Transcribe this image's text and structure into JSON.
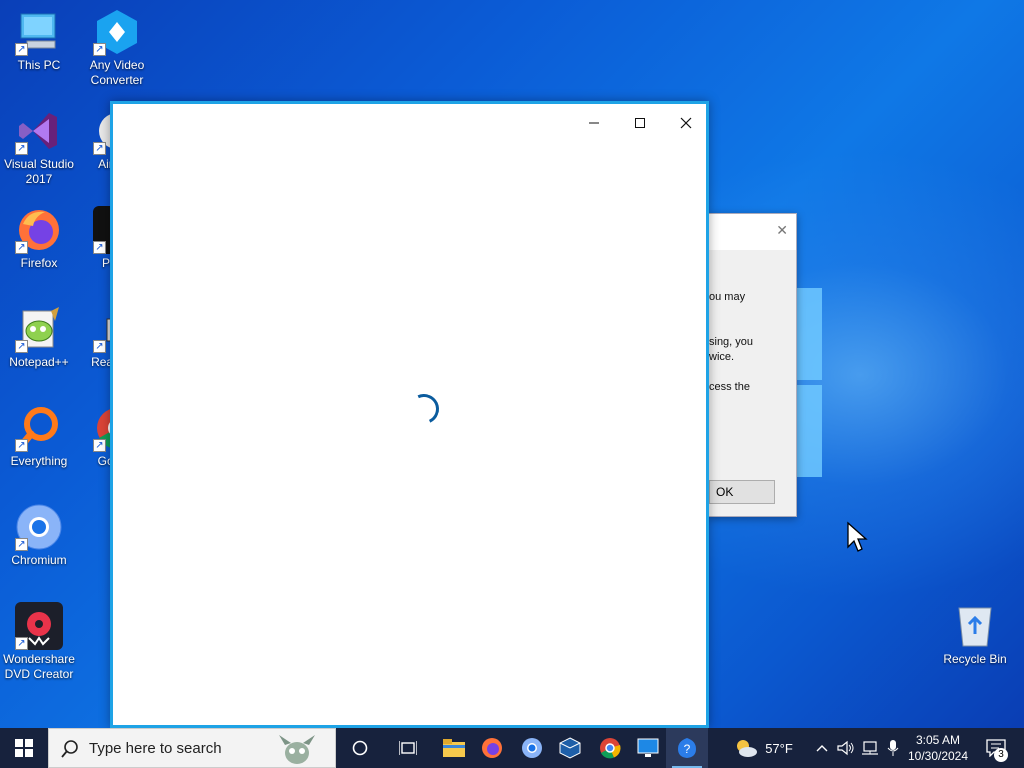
{
  "desktop": {
    "icons_left": [
      {
        "label": "This PC",
        "icon": "computer-icon"
      },
      {
        "label": "Visual Studio 2017",
        "icon": "visual-studio-icon"
      },
      {
        "label": "Firefox",
        "icon": "firefox-icon"
      },
      {
        "label": "Notepad++",
        "icon": "notepad-plus-plus-icon"
      },
      {
        "label": "Everything",
        "icon": "everything-search-icon"
      },
      {
        "label": "Chromium",
        "icon": "chromium-icon"
      },
      {
        "label": "Wondershare DVD Creator",
        "icon": "wondershare-dvd-icon"
      }
    ],
    "icons_second": [
      {
        "label": "Any Video Converter",
        "icon": "any-video-converter-icon"
      },
      {
        "label": "Ain Vid",
        "icon": "aimersoft-icon"
      },
      {
        "label": "Powe",
        "icon": "power-icon"
      },
      {
        "label": "Real Vide",
        "icon": "realplayer-icon"
      },
      {
        "label": "Go Chr",
        "icon": "chrome-icon"
      }
    ],
    "recycle_bin": {
      "label": "Recycle Bin",
      "icon": "recycle-bin-icon"
    }
  },
  "dialog": {
    "lines": [
      "ou may",
      "sing, you",
      "wice.",
      "cess the"
    ],
    "ok_label": "OK",
    "close_glyph": "✕"
  },
  "main_window": {
    "minimize_glyph": "—",
    "close_glyph": "✕",
    "state": "loading"
  },
  "taskbar": {
    "search_placeholder": "Type here to search",
    "weather": "57°F",
    "time": "3:05 AM",
    "date": "10/30/2024",
    "notification_count": "3",
    "apps": [
      "cortana-icon",
      "task-view-icon",
      "file-explorer-icon",
      "firefox-icon",
      "chromium-icon",
      "virtualbox-icon",
      "chrome-icon",
      "remote-desktop-icon",
      "help-icon"
    ]
  },
  "colors": {
    "window_border": "#1ea3e6",
    "spinner": "#0b5c9e",
    "taskbar": "#17223d"
  }
}
